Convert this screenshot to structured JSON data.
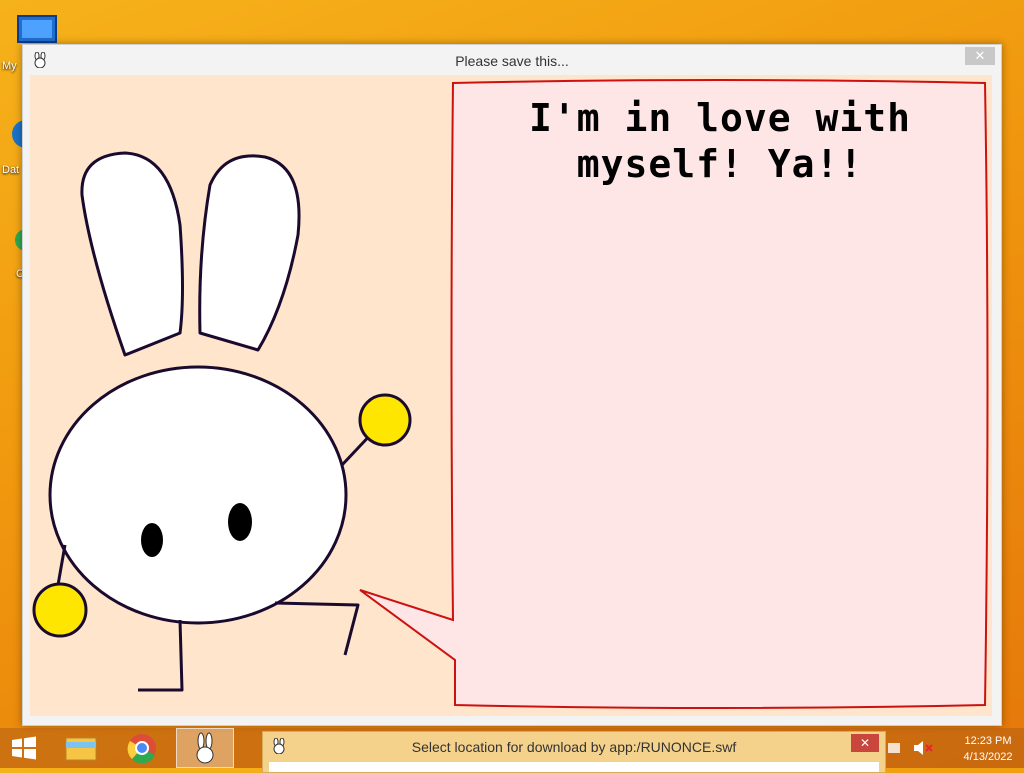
{
  "desktop": {
    "icons": [
      {
        "name": "my-computer-icon",
        "label": "My"
      },
      {
        "name": "data-icon",
        "label": "Dat"
      },
      {
        "name": "chrome-desktop-icon",
        "label": "C"
      }
    ]
  },
  "window": {
    "title": "Please save this...",
    "close_glyph": "✕"
  },
  "speech": {
    "line1": "I'm in love with",
    "line2": "myself! Ya!!"
  },
  "taskbar": {
    "clock_time": "12:23 PM",
    "clock_date": "4/13/2022",
    "items": [
      "start-icon",
      "file-explorer-icon",
      "chrome-icon",
      "bunny-app-icon"
    ]
  },
  "dialog": {
    "title": "Select location for download by app:/RUNONCE.swf",
    "close_glyph": "✕"
  },
  "colors": {
    "stage_bg": "#fee5cb",
    "bubble_fill": "#fee6e6",
    "bubble_border": "#cc1111",
    "bunny_fill": "#ffffff",
    "bunny_outline": "#1a0a2e",
    "hand_fill": "#ffe600"
  }
}
